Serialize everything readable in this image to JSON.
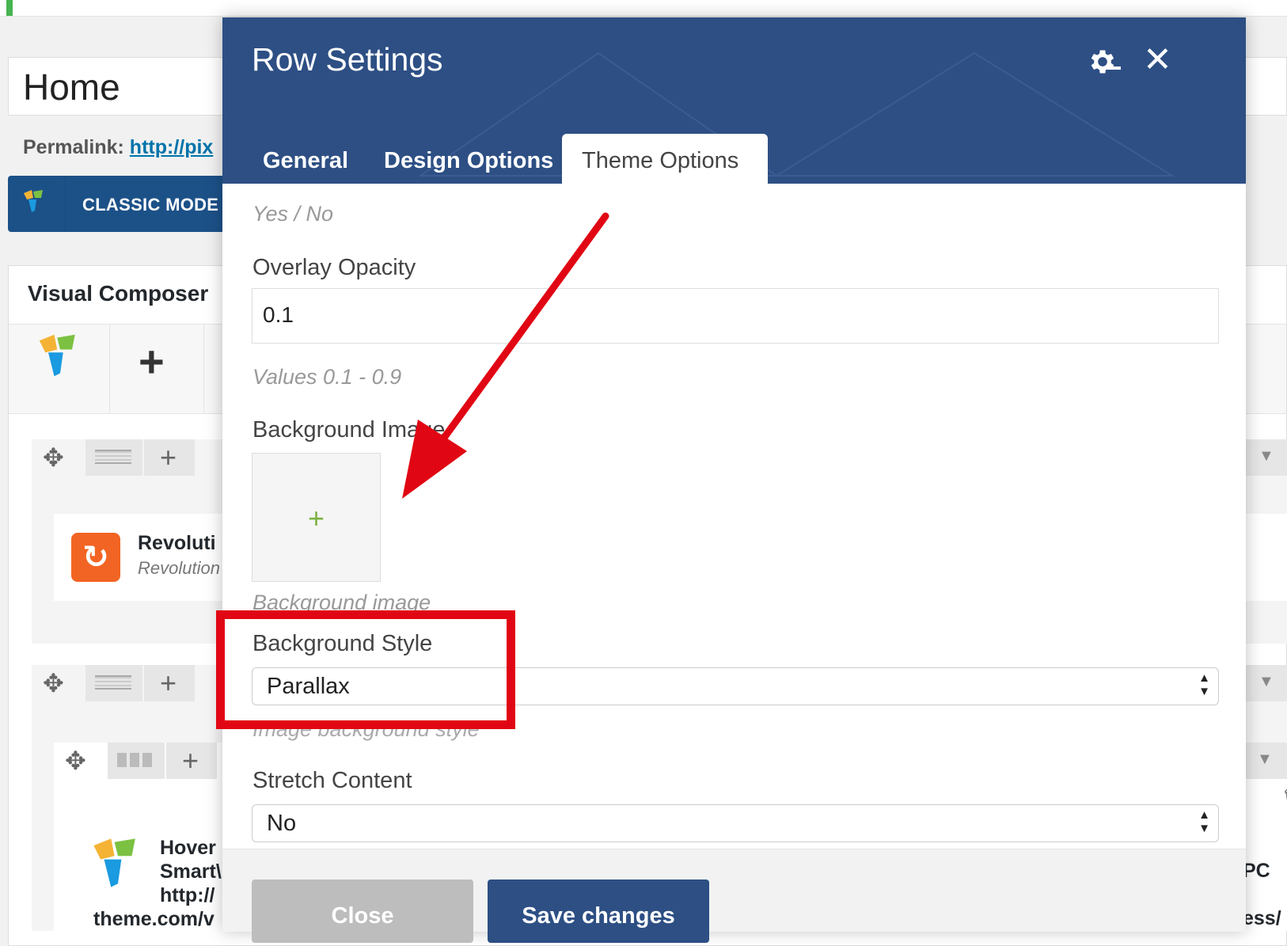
{
  "page": {
    "title": "Home",
    "permalink_label": "Permalink:",
    "permalink_url": "http://pix",
    "classic_mode_label": "CLASSIC MODE"
  },
  "composer": {
    "title": "Visual Composer",
    "elements": [
      {
        "name": "Revoluti",
        "desc": "Revolution"
      },
      {
        "name_lines": [
          "Hover",
          "Smart\\",
          "http://",
          "theme.com/v"
        ]
      }
    ],
    "right_fragments": [
      "PC",
      "ess/"
    ]
  },
  "modal": {
    "title": "Row Settings",
    "tabs": [
      {
        "label": "General",
        "active": false
      },
      {
        "label": "Design Options",
        "active": false
      },
      {
        "label": "Theme Options",
        "active": true
      }
    ],
    "fields": {
      "top_help": "Yes / No",
      "overlay_opacity": {
        "label": "Overlay Opacity",
        "value": "0.1",
        "help": "Values 0.1 - 0.9"
      },
      "background_image": {
        "label": "Background Image",
        "help": "Background image"
      },
      "background_style": {
        "label": "Background Style",
        "value": "Parallax",
        "help": "Image background style"
      },
      "stretch_content": {
        "label": "Stretch Content",
        "value": "No"
      }
    },
    "buttons": {
      "close": "Close",
      "save": "Save changes"
    }
  },
  "annotation": {
    "color": "#e10613"
  },
  "colors": {
    "modal_header": "#2d4f84",
    "wp_blue": "#1c5188",
    "accent_green": "#7cb342"
  }
}
